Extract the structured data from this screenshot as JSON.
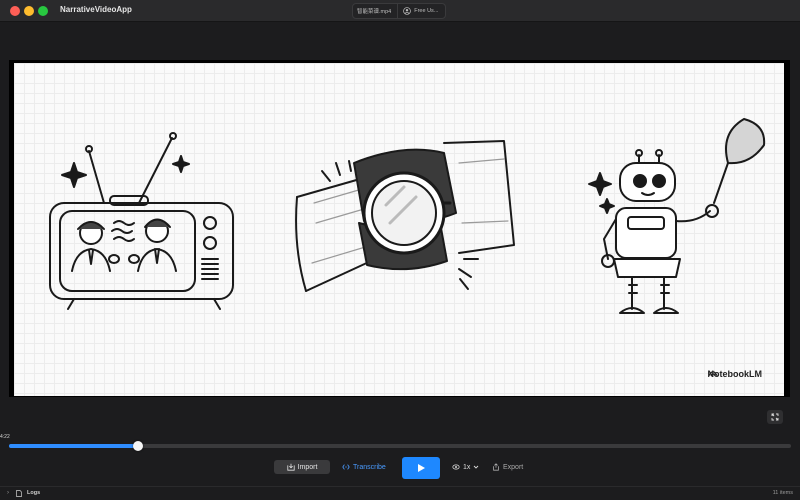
{
  "window": {
    "title": "NarrativeVideoApp",
    "file_tab": "智能菜谱.mp4",
    "user_tab": "Free Us..."
  },
  "video": {
    "watermark": "NotebookLM"
  },
  "timeline": {
    "current_time": "4:22",
    "progress": 0.165
  },
  "controls": {
    "import_label": "Import",
    "transcribe_label": "Transcribe",
    "speed_label": "1x",
    "export_label": "Export"
  },
  "status": {
    "logs_label": "Logs",
    "items_count": "11 items"
  },
  "colors": {
    "accent": "#1e88ff",
    "progress_fill": "#2f8dff"
  },
  "icons": [
    "user-icon",
    "fullscreen-icon",
    "import-icon",
    "transcribe-icon",
    "play-icon",
    "eye-icon",
    "chevron-down-icon",
    "export-icon",
    "log-icon",
    "notebooklm-icon"
  ]
}
